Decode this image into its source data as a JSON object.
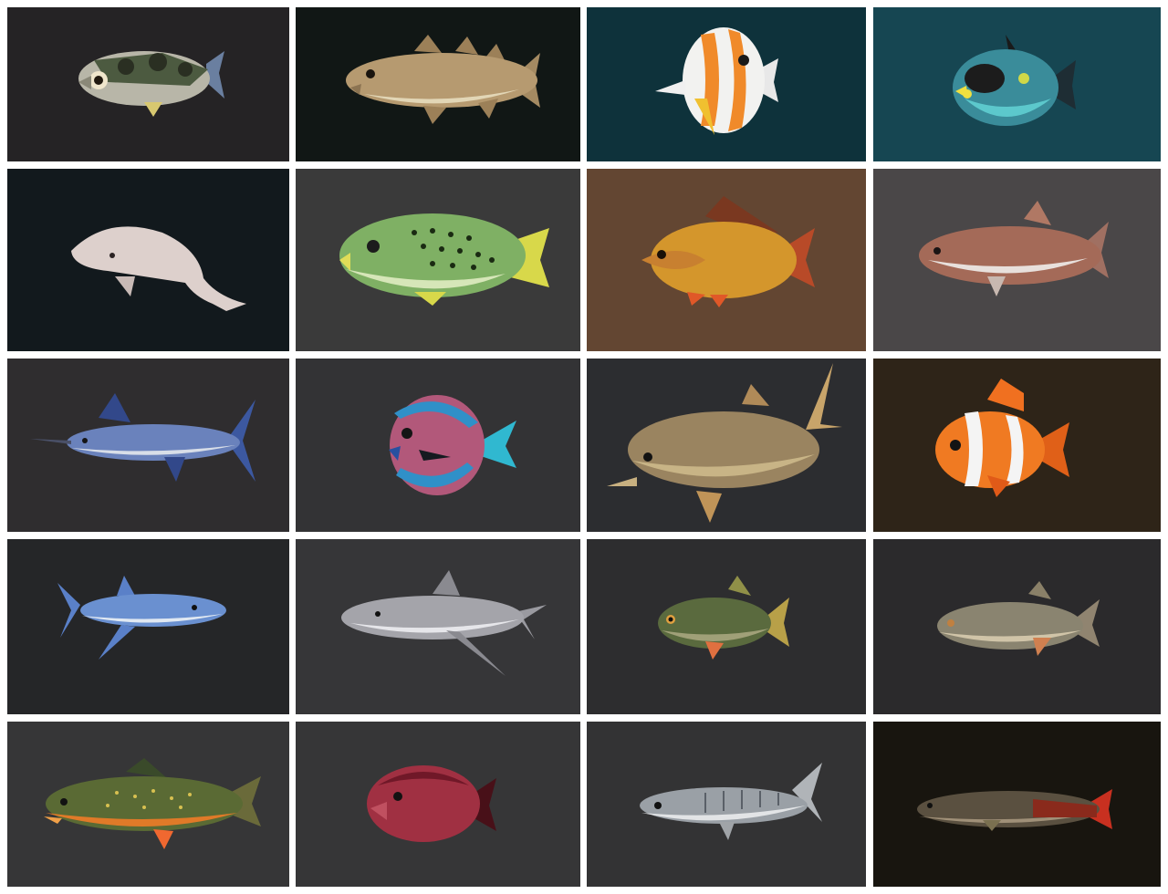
{
  "gallery": {
    "tiles": [
      {
        "subject": "archerfish-icon",
        "bg": "#252325"
      },
      {
        "subject": "cod-icon",
        "bg": "#111715"
      },
      {
        "subject": "butterflyfish-icon",
        "bg": "#0e323b"
      },
      {
        "subject": "triggerfish-icon",
        "bg": "#164652"
      },
      {
        "subject": "sperm-whale-icon",
        "bg": "#12191d"
      },
      {
        "subject": "sweetlips-icon",
        "bg": "#3a3a3a"
      },
      {
        "subject": "carp-icon",
        "bg": "#634632"
      },
      {
        "subject": "salmon-icon",
        "bg": "#4a4748"
      },
      {
        "subject": "marlin-icon",
        "bg": "#2f2d2f"
      },
      {
        "subject": "surgeonfish-icon",
        "bg": "#333335"
      },
      {
        "subject": "yellowtail-icon",
        "bg": "#2c2d30"
      },
      {
        "subject": "clownfish-icon",
        "bg": "#2e2418"
      },
      {
        "subject": "blue-shark-icon",
        "bg": "#252628"
      },
      {
        "subject": "bull-shark-icon",
        "bg": "#363638"
      },
      {
        "subject": "roach-fish-icon",
        "bg": "#2d2d2f"
      },
      {
        "subject": "grass-carp-icon",
        "bg": "#2b2a2c"
      },
      {
        "subject": "brook-trout-icon",
        "bg": "#363637"
      },
      {
        "subject": "grouper-icon",
        "bg": "#363637"
      },
      {
        "subject": "barracuda-icon",
        "bg": "#333334"
      },
      {
        "subject": "arapaima-icon",
        "bg": "#18150f"
      }
    ]
  }
}
